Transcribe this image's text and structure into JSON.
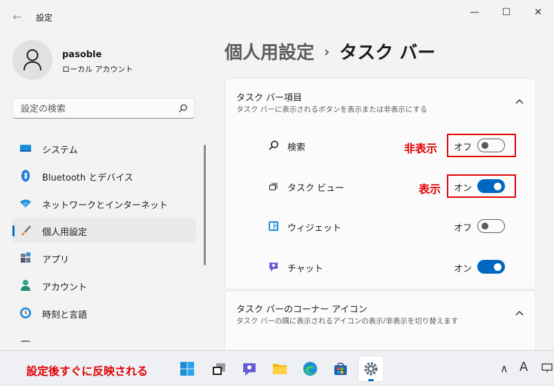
{
  "window": {
    "back_glyph": "←",
    "title": "設定",
    "controls": {
      "minimize": "—",
      "maximize": "☐",
      "close": "✕"
    }
  },
  "user": {
    "name": "pasoble",
    "account_type": "ローカル アカウント"
  },
  "search": {
    "placeholder": "設定の検索"
  },
  "nav": {
    "items": [
      {
        "label": "システム",
        "icon": "monitor-icon",
        "active": false
      },
      {
        "label": "Bluetooth とデバイス",
        "icon": "bluetooth-icon",
        "active": false
      },
      {
        "label": "ネットワークとインターネット",
        "icon": "wifi-icon",
        "active": false
      },
      {
        "label": "個人用設定",
        "icon": "brush-icon",
        "active": true
      },
      {
        "label": "アプリ",
        "icon": "apps-icon",
        "active": false
      },
      {
        "label": "アカウント",
        "icon": "person-icon",
        "active": false
      },
      {
        "label": "時刻と言語",
        "icon": "clock-globe-icon",
        "active": false
      }
    ]
  },
  "breadcrumb": {
    "parent": "個人用設定",
    "separator": "›",
    "current": "タスク バー"
  },
  "taskbar_items_section": {
    "title": "タスク バー項目",
    "subtitle": "タスク バーに表示されるボタンを表示または非表示にする",
    "items": [
      {
        "label": "検索",
        "state": "オフ",
        "on": false,
        "icon": "search-icon"
      },
      {
        "label": "タスク ビュー",
        "state": "オン",
        "on": true,
        "icon": "task-view-icon"
      },
      {
        "label": "ウィジェット",
        "state": "オフ",
        "on": false,
        "icon": "widgets-icon"
      },
      {
        "label": "チャット",
        "state": "オン",
        "on": true,
        "icon": "chat-icon"
      }
    ]
  },
  "corner_section": {
    "title": "タスク バーのコーナー アイコン",
    "subtitle": "タスク バーの隅に表示されるアイコンの表示/非表示を切り替えます"
  },
  "annotations": {
    "hide_label": "非表示",
    "show_label": "表示",
    "taskbar_note": "設定後すぐに反映される"
  },
  "taskbar": {
    "apps": [
      "start-icon",
      "task-view-icon",
      "chat-icon",
      "file-explorer-icon",
      "edge-icon",
      "store-icon",
      "settings-icon"
    ],
    "tray": {
      "chevron": "∧",
      "ime": "A"
    }
  },
  "colors": {
    "accent": "#0067c0",
    "annotation_red": "#e00000"
  }
}
